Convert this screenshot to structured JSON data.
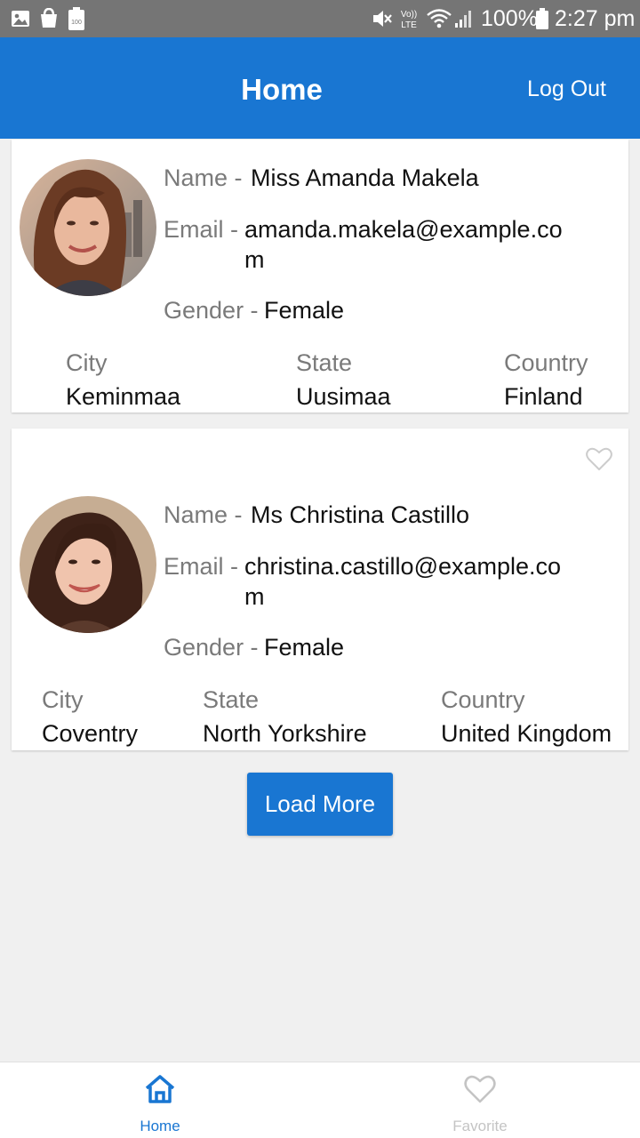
{
  "status_bar": {
    "battery": "100%",
    "time": "2:27 pm",
    "volte": "Vo)) LTE",
    "battery_small": "100"
  },
  "app_bar": {
    "title": "Home",
    "logout_label": "Log Out"
  },
  "labels": {
    "name": "Name -",
    "email": "Email -",
    "gender": "Gender -",
    "city": "City",
    "state": "State",
    "country": "Country"
  },
  "users": [
    {
      "name": "Miss Amanda Makela",
      "email": "amanda.makela@example.com",
      "gender": "Female",
      "city": "Keminmaa",
      "state": "Uusimaa",
      "country": "Finland",
      "favorite_icon_visible": false
    },
    {
      "name": "Ms Christina Castillo",
      "email": "christina.castillo@example.com",
      "gender": "Female",
      "city": "Coventry",
      "state": "North Yorkshire",
      "country": "United Kingdom",
      "favorite_icon_visible": true
    }
  ],
  "load_more_label": "Load More",
  "bottom_nav": [
    {
      "label": "Home",
      "icon": "home-icon",
      "active": true
    },
    {
      "label": "Favorite",
      "icon": "heart-icon",
      "active": false
    }
  ],
  "colors": {
    "primary": "#1976d2",
    "status_bar": "#757575",
    "background": "#f0f0f0",
    "label_gray": "#7a7a7a",
    "inactive": "#c4c4c4"
  }
}
